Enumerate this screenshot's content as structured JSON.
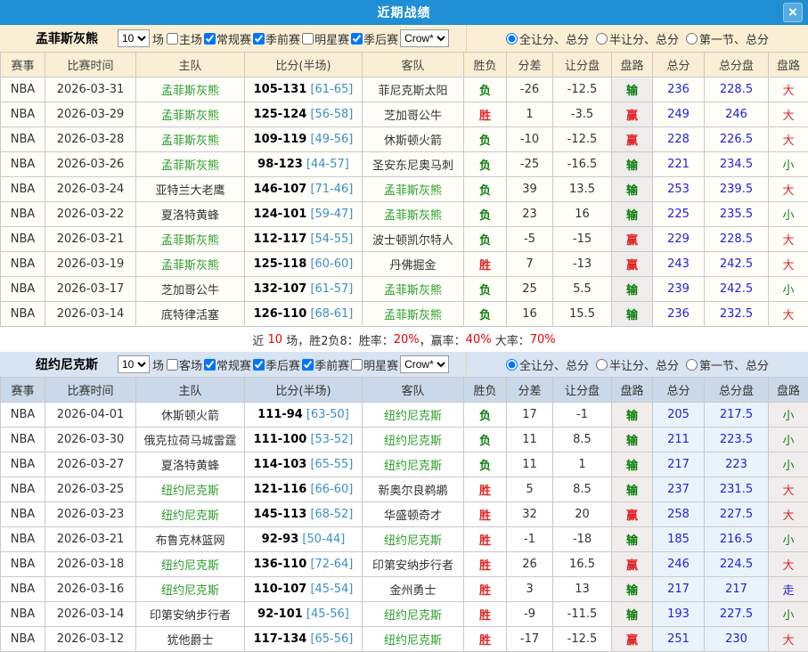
{
  "dialog": {
    "title": "近期战绩",
    "close_glyph": "×"
  },
  "colors": {
    "titlebar_blue": "#1E8FD5",
    "beige_panel": "#FAEFD4",
    "blue_panel": "#D8E4F2",
    "team_green": "#2B9E2B",
    "win_red": "#E02626",
    "lose_green": "#0A7F0A",
    "push_blue": "#2222DD",
    "total_blue": "#2222DD",
    "halftime_blue": "#3A8FC7"
  },
  "columns": [
    "赛事",
    "比赛时间",
    "主队",
    "比分(半场)",
    "客队",
    "胜负",
    "分差",
    "让分盘",
    "盘路",
    "总分",
    "总分盘",
    "盘路"
  ],
  "scope_options": [
    "全让分、总分",
    "半让分、总分",
    "第一节、总分"
  ],
  "sections": [
    {
      "theme": "beige",
      "team": "孟菲斯灰熊",
      "games_count": "10",
      "games_suffix": "场",
      "filters": [
        {
          "label": "主场",
          "checked": false
        },
        {
          "label": "常规赛",
          "checked": true
        },
        {
          "label": "季前赛",
          "checked": true
        },
        {
          "label": "明星赛",
          "checked": false
        },
        {
          "label": "季后赛",
          "checked": true
        }
      ],
      "bookmaker": "Crow*",
      "radio_selected": 0,
      "rows": [
        {
          "league": "NBA",
          "date": "2026-03-31",
          "home": "孟菲斯灰熊",
          "home_is_team": true,
          "score": "105-131",
          "half": "[61-65]",
          "away": "菲尼克斯太阳",
          "away_is_team": false,
          "result": "负",
          "diff": "-26",
          "handicap": "-12.5",
          "handicap_result": "输",
          "total": "236",
          "total_line": "228.5",
          "ou": "大"
        },
        {
          "league": "NBA",
          "date": "2026-03-29",
          "home": "孟菲斯灰熊",
          "home_is_team": true,
          "score": "125-124",
          "half": "[56-58]",
          "away": "芝加哥公牛",
          "away_is_team": false,
          "result": "胜",
          "diff": "1",
          "handicap": "-3.5",
          "handicap_result": "赢",
          "total": "249",
          "total_line": "246",
          "ou": "大"
        },
        {
          "league": "NBA",
          "date": "2026-03-28",
          "home": "孟菲斯灰熊",
          "home_is_team": true,
          "score": "109-119",
          "half": "[49-56]",
          "away": "休斯顿火箭",
          "away_is_team": false,
          "result": "负",
          "diff": "-10",
          "handicap": "-12.5",
          "handicap_result": "赢",
          "total": "228",
          "total_line": "226.5",
          "ou": "大"
        },
        {
          "league": "NBA",
          "date": "2026-03-26",
          "home": "孟菲斯灰熊",
          "home_is_team": true,
          "score": "98-123",
          "half": "[44-57]",
          "away": "圣安东尼奥马刺",
          "away_is_team": false,
          "result": "负",
          "diff": "-25",
          "handicap": "-16.5",
          "handicap_result": "输",
          "total": "221",
          "total_line": "234.5",
          "ou": "小"
        },
        {
          "league": "NBA",
          "date": "2026-03-24",
          "home": "亚特兰大老鹰",
          "home_is_team": false,
          "score": "146-107",
          "half": "[71-46]",
          "away": "孟菲斯灰熊",
          "away_is_team": true,
          "result": "负",
          "diff": "39",
          "handicap": "13.5",
          "handicap_result": "输",
          "total": "253",
          "total_line": "239.5",
          "ou": "大"
        },
        {
          "league": "NBA",
          "date": "2026-03-22",
          "home": "夏洛特黄蜂",
          "home_is_team": false,
          "score": "124-101",
          "half": "[59-47]",
          "away": "孟菲斯灰熊",
          "away_is_team": true,
          "result": "负",
          "diff": "23",
          "handicap": "16",
          "handicap_result": "输",
          "total": "225",
          "total_line": "235.5",
          "ou": "小"
        },
        {
          "league": "NBA",
          "date": "2026-03-21",
          "home": "孟菲斯灰熊",
          "home_is_team": true,
          "score": "112-117",
          "half": "[54-55]",
          "away": "波士顿凯尔特人",
          "away_is_team": false,
          "result": "负",
          "diff": "-5",
          "handicap": "-15",
          "handicap_result": "赢",
          "total": "229",
          "total_line": "228.5",
          "ou": "大"
        },
        {
          "league": "NBA",
          "date": "2026-03-19",
          "home": "孟菲斯灰熊",
          "home_is_team": true,
          "score": "125-118",
          "half": "[60-60]",
          "away": "丹佛掘金",
          "away_is_team": false,
          "result": "胜",
          "diff": "7",
          "handicap": "-13",
          "handicap_result": "赢",
          "total": "243",
          "total_line": "242.5",
          "ou": "大"
        },
        {
          "league": "NBA",
          "date": "2026-03-17",
          "home": "芝加哥公牛",
          "home_is_team": false,
          "score": "132-107",
          "half": "[61-57]",
          "away": "孟菲斯灰熊",
          "away_is_team": true,
          "result": "负",
          "diff": "25",
          "handicap": "5.5",
          "handicap_result": "输",
          "total": "239",
          "total_line": "242.5",
          "ou": "小"
        },
        {
          "league": "NBA",
          "date": "2026-03-14",
          "home": "底特律活塞",
          "home_is_team": false,
          "score": "126-110",
          "half": "[68-61]",
          "away": "孟菲斯灰熊",
          "away_is_team": true,
          "result": "负",
          "diff": "16",
          "handicap": "15.5",
          "handicap_result": "输",
          "total": "236",
          "total_line": "232.5",
          "ou": "大"
        }
      ],
      "summary": [
        {
          "t": "近 ",
          "hot": false
        },
        {
          "t": "10",
          "hot": true
        },
        {
          "t": " 场，胜2负8：胜率：",
          "hot": false
        },
        {
          "t": "20%",
          "hot": true
        },
        {
          "t": "，赢率：",
          "hot": false
        },
        {
          "t": "40%",
          "hot": true
        },
        {
          "t": " 大率：",
          "hot": false
        },
        {
          "t": "70%",
          "hot": true
        }
      ]
    },
    {
      "theme": "blue",
      "team": "纽约尼克斯",
      "games_count": "10",
      "games_suffix": "场",
      "filters": [
        {
          "label": "客场",
          "checked": false
        },
        {
          "label": "常规赛",
          "checked": true
        },
        {
          "label": "季后赛",
          "checked": true
        },
        {
          "label": "季前赛",
          "checked": true
        },
        {
          "label": "明星赛",
          "checked": false
        }
      ],
      "bookmaker": "Crow*",
      "radio_selected": 0,
      "rows": [
        {
          "league": "NBA",
          "date": "2026-04-01",
          "home": "休斯顿火箭",
          "home_is_team": false,
          "score": "111-94",
          "half": "[63-50]",
          "away": "纽约尼克斯",
          "away_is_team": true,
          "result": "负",
          "diff": "17",
          "handicap": "-1",
          "handicap_result": "输",
          "total": "205",
          "total_line": "217.5",
          "ou": "小"
        },
        {
          "league": "NBA",
          "date": "2026-03-30",
          "home": "俄克拉荷马城雷霆",
          "home_is_team": false,
          "score": "111-100",
          "half": "[53-52]",
          "away": "纽约尼克斯",
          "away_is_team": true,
          "result": "负",
          "diff": "11",
          "handicap": "8.5",
          "handicap_result": "输",
          "total": "211",
          "total_line": "223.5",
          "ou": "小"
        },
        {
          "league": "NBA",
          "date": "2026-03-27",
          "home": "夏洛特黄蜂",
          "home_is_team": false,
          "score": "114-103",
          "half": "[65-55]",
          "away": "纽约尼克斯",
          "away_is_team": true,
          "result": "负",
          "diff": "11",
          "handicap": "1",
          "handicap_result": "输",
          "total": "217",
          "total_line": "223",
          "ou": "小"
        },
        {
          "league": "NBA",
          "date": "2026-03-25",
          "home": "纽约尼克斯",
          "home_is_team": true,
          "score": "121-116",
          "half": "[66-60]",
          "away": "新奥尔良鹈鹕",
          "away_is_team": false,
          "result": "胜",
          "diff": "5",
          "handicap": "8.5",
          "handicap_result": "输",
          "total": "237",
          "total_line": "231.5",
          "ou": "大"
        },
        {
          "league": "NBA",
          "date": "2026-03-23",
          "home": "纽约尼克斯",
          "home_is_team": true,
          "score": "145-113",
          "half": "[68-52]",
          "away": "华盛顿奇才",
          "away_is_team": false,
          "result": "胜",
          "diff": "32",
          "handicap": "20",
          "handicap_result": "赢",
          "total": "258",
          "total_line": "227.5",
          "ou": "大"
        },
        {
          "league": "NBA",
          "date": "2026-03-21",
          "home": "布鲁克林篮网",
          "home_is_team": false,
          "score": "92-93",
          "half": "[50-44]",
          "away": "纽约尼克斯",
          "away_is_team": true,
          "result": "胜",
          "diff": "-1",
          "handicap": "-18",
          "handicap_result": "输",
          "total": "185",
          "total_line": "216.5",
          "ou": "小"
        },
        {
          "league": "NBA",
          "date": "2026-03-18",
          "home": "纽约尼克斯",
          "home_is_team": true,
          "score": "136-110",
          "half": "[72-64]",
          "away": "印第安纳步行者",
          "away_is_team": false,
          "result": "胜",
          "diff": "26",
          "handicap": "16.5",
          "handicap_result": "赢",
          "total": "246",
          "total_line": "224.5",
          "ou": "大"
        },
        {
          "league": "NBA",
          "date": "2026-03-16",
          "home": "纽约尼克斯",
          "home_is_team": true,
          "score": "110-107",
          "half": "[45-54]",
          "away": "金州勇士",
          "away_is_team": false,
          "result": "胜",
          "diff": "3",
          "handicap": "13",
          "handicap_result": "输",
          "total": "217",
          "total_line": "217",
          "ou": "走"
        },
        {
          "league": "NBA",
          "date": "2026-03-14",
          "home": "印第安纳步行者",
          "home_is_team": false,
          "score": "92-101",
          "half": "[45-56]",
          "away": "纽约尼克斯",
          "away_is_team": true,
          "result": "胜",
          "diff": "-9",
          "handicap": "-11.5",
          "handicap_result": "输",
          "total": "193",
          "total_line": "227.5",
          "ou": "小"
        },
        {
          "league": "NBA",
          "date": "2026-03-12",
          "home": "犹他爵士",
          "home_is_team": false,
          "score": "117-134",
          "half": "[65-56]",
          "away": "纽约尼克斯",
          "away_is_team": true,
          "result": "胜",
          "diff": "-17",
          "handicap": "-12.5",
          "handicap_result": "赢",
          "total": "251",
          "total_line": "230",
          "ou": "大"
        }
      ],
      "summary": null
    }
  ]
}
